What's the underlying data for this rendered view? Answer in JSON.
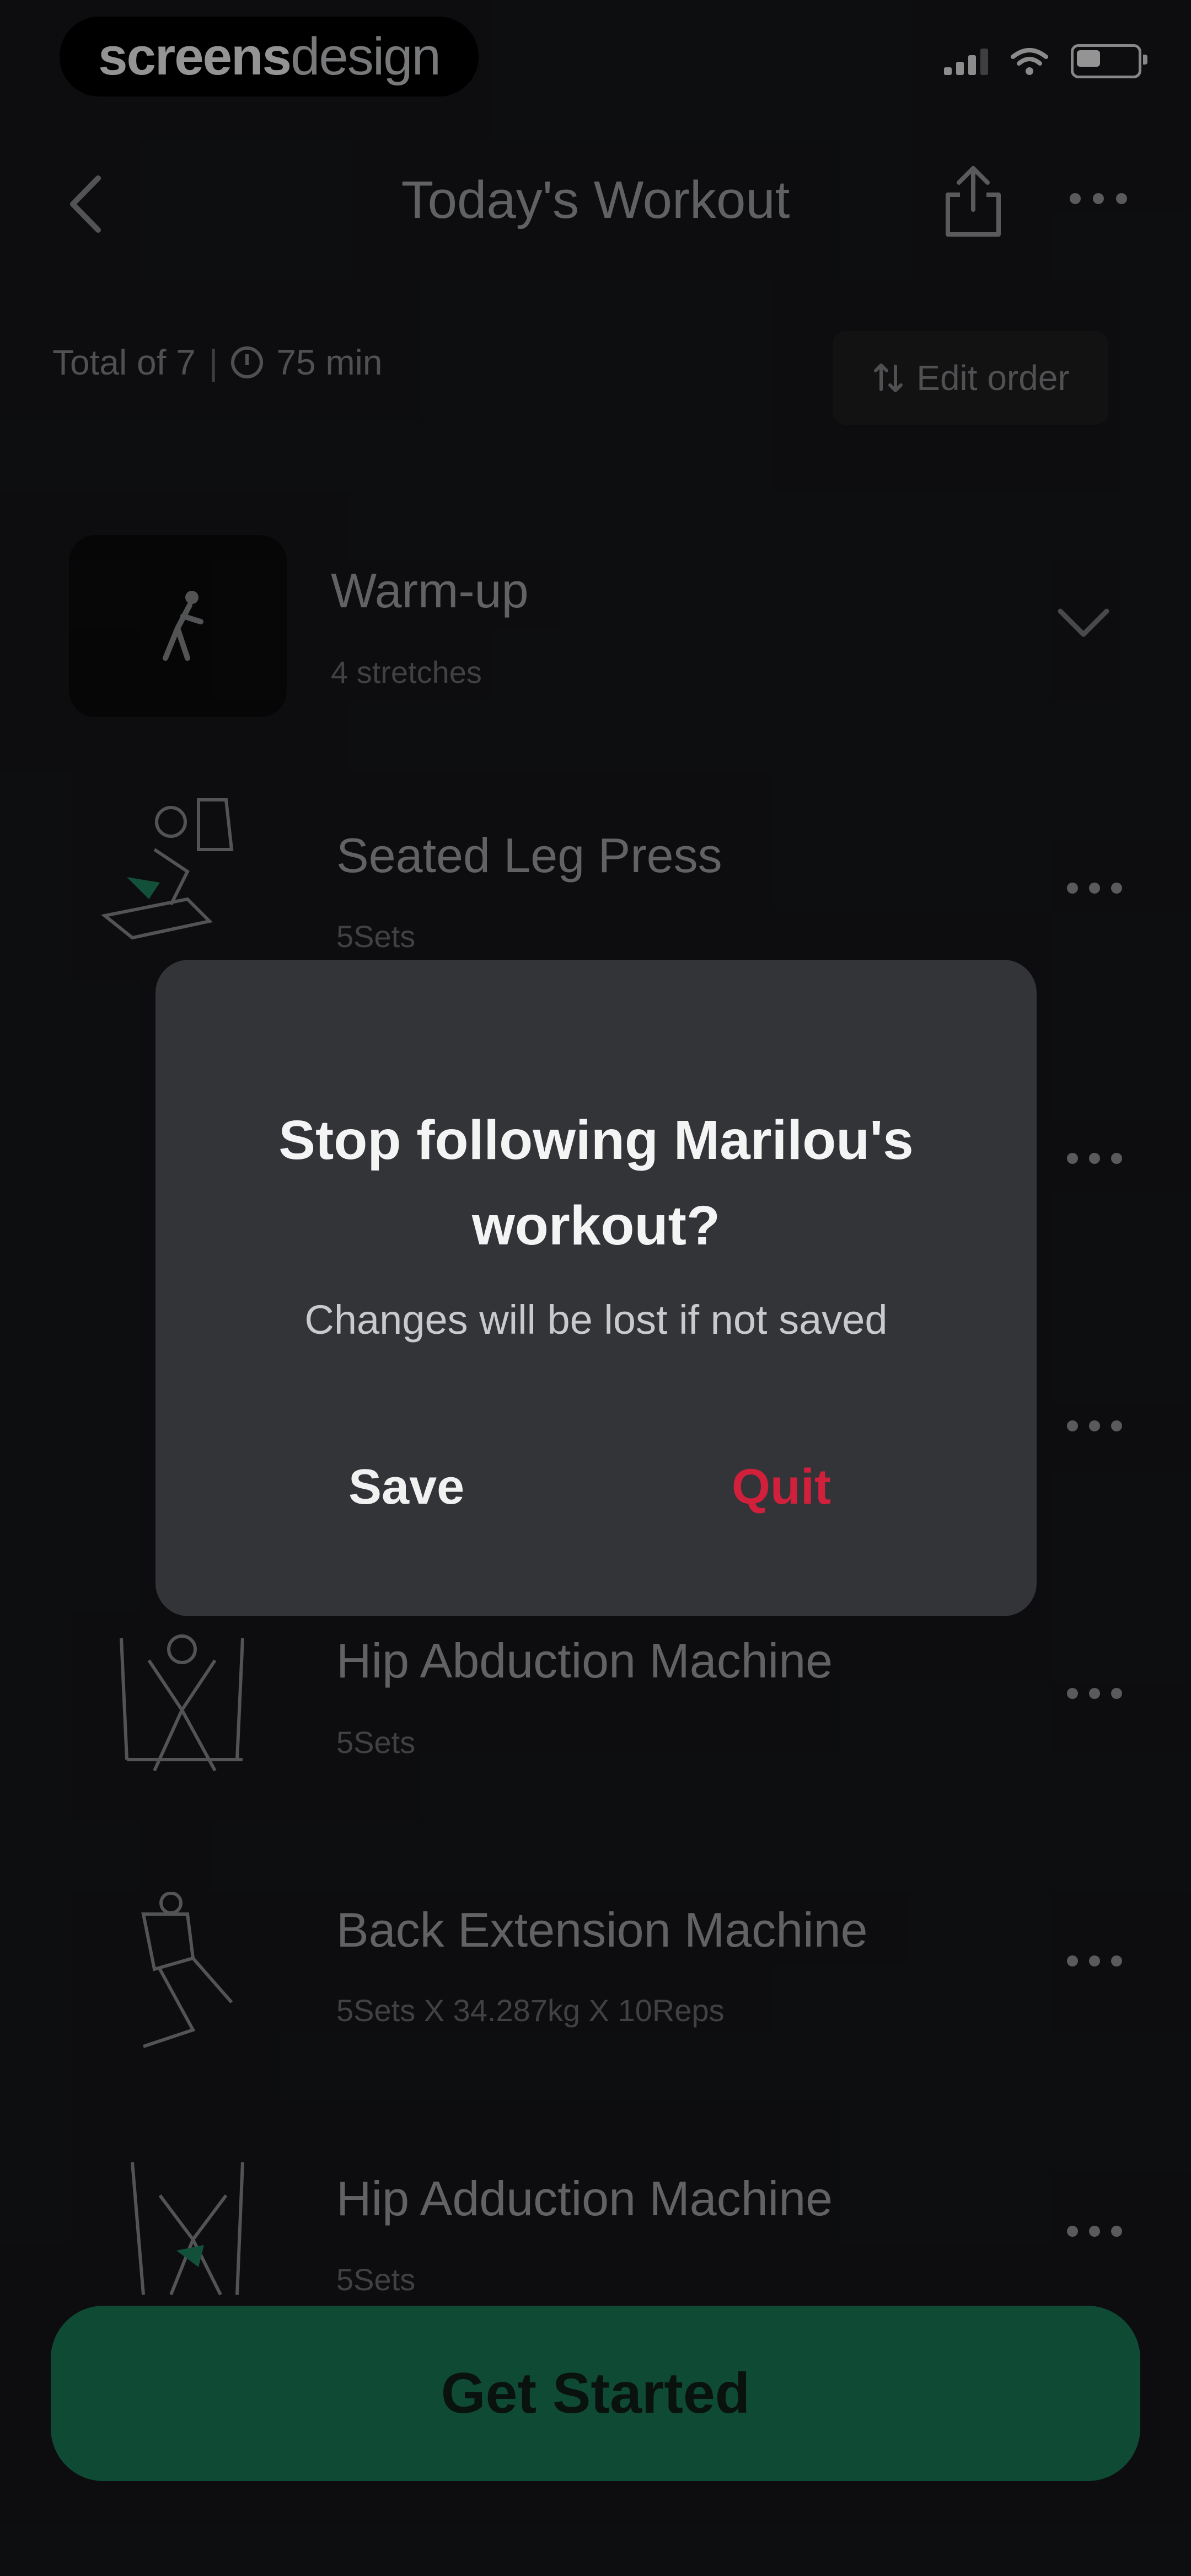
{
  "status_bar": {
    "brand_part1": "screens",
    "brand_part2": "design"
  },
  "nav": {
    "title": "Today's Workout",
    "back_icon": "chevron-left-icon",
    "share_icon": "share-icon",
    "more_icon": "more-horizontal-icon"
  },
  "summary": {
    "total": "Total of 7",
    "separator": "|",
    "duration": "75 min",
    "edit_order_label": "Edit order"
  },
  "list": {
    "warmup": {
      "title": "Warm-up",
      "subtitle": "4 stretches"
    },
    "items": [
      {
        "title": "Seated Leg Press",
        "subtitle": "5Sets"
      },
      {
        "title": "Hip Abduction Machine",
        "subtitle": "5Sets"
      },
      {
        "title": "Back Extension Machine",
        "subtitle": "5Sets X 34.287kg X 10Reps"
      },
      {
        "title": "Hip Adduction Machine",
        "subtitle": "5Sets"
      }
    ]
  },
  "dialog": {
    "title": "Stop following Marilou's workout?",
    "message": "Changes will be lost if not saved",
    "save_label": "Save",
    "quit_label": "Quit"
  },
  "cta": {
    "label": "Get Started"
  },
  "colors": {
    "background": "#17181a",
    "dialog": "#323438",
    "quit": "#d0203c",
    "cta": "#0e4a34",
    "accent_green": "#1f8a63"
  }
}
